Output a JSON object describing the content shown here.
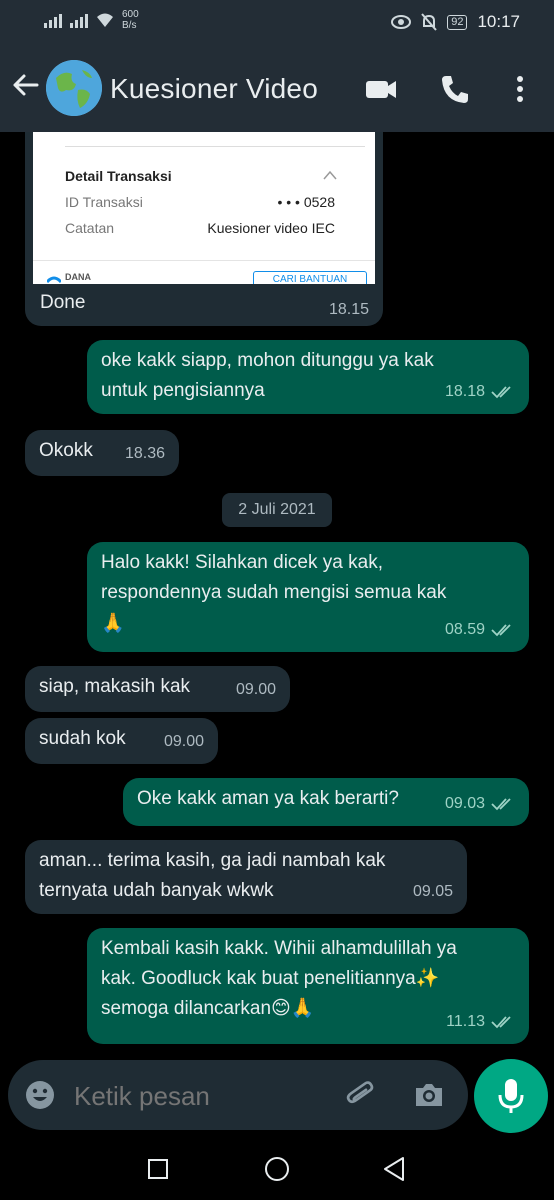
{
  "status_bar": {
    "net_speed_value": "600",
    "net_speed_unit": "B/s",
    "battery": "92",
    "time": "10:17"
  },
  "header": {
    "contact_name": "Kuesioner Video"
  },
  "receipt": {
    "section_title": "Detail Transaksi",
    "rows": [
      {
        "label": "ID Transaksi",
        "value": "• • • 0528"
      },
      {
        "label": "Catatan",
        "value": "Kuesioner video IEC"
      }
    ],
    "brand": "DANA",
    "help_button": "CARI BANTUAN"
  },
  "messages": [
    {
      "dir": "in",
      "text": "Done",
      "time": "18.15"
    },
    {
      "dir": "out",
      "lines": [
        "oke kakk siapp, mohon ditunggu ya kak",
        "untuk pengisiannya"
      ],
      "time": "18.18"
    },
    {
      "dir": "in",
      "text": "Okokk",
      "time": "18.36"
    },
    {
      "dir": "out",
      "lines": [
        "Halo kakk! Silahkan dicek ya kak,",
        "respondennya sudah mengisi semua kak",
        "🙏"
      ],
      "time": "08.59"
    },
    {
      "dir": "in",
      "text": "siap, makasih kak",
      "time": "09.00"
    },
    {
      "dir": "in",
      "text": "sudah kok",
      "time": "09.00"
    },
    {
      "dir": "out",
      "text": "Oke kakk aman ya kak berarti?",
      "time": "09.03"
    },
    {
      "dir": "in",
      "lines": [
        "aman... terima kasih, ga jadi nambah kak",
        "ternyata udah banyak wkwk"
      ],
      "time": "09.05"
    },
    {
      "dir": "out",
      "lines": [
        "Kembali kasih kakk. Wihii alhamdulillah ya",
        "kak. Goodluck kak buat penelitiannya✨",
        "semoga dilancarkan😊🙏"
      ],
      "time": "11.13"
    }
  ],
  "date_divider": "2 Juli 2021",
  "composer": {
    "placeholder": "Ketik pesan"
  },
  "colors": {
    "incoming_bubble": "#1f2c34",
    "outgoing_bubble": "#005c4b",
    "accent": "#00a884",
    "header_bg": "#232d36"
  },
  "icons": [
    "back-arrow-icon",
    "avatar-globe",
    "video-call-icon",
    "phone-icon",
    "more-vert-icon",
    "emoji-icon",
    "attach-icon",
    "camera-icon",
    "mic-icon",
    "double-check-icon"
  ]
}
